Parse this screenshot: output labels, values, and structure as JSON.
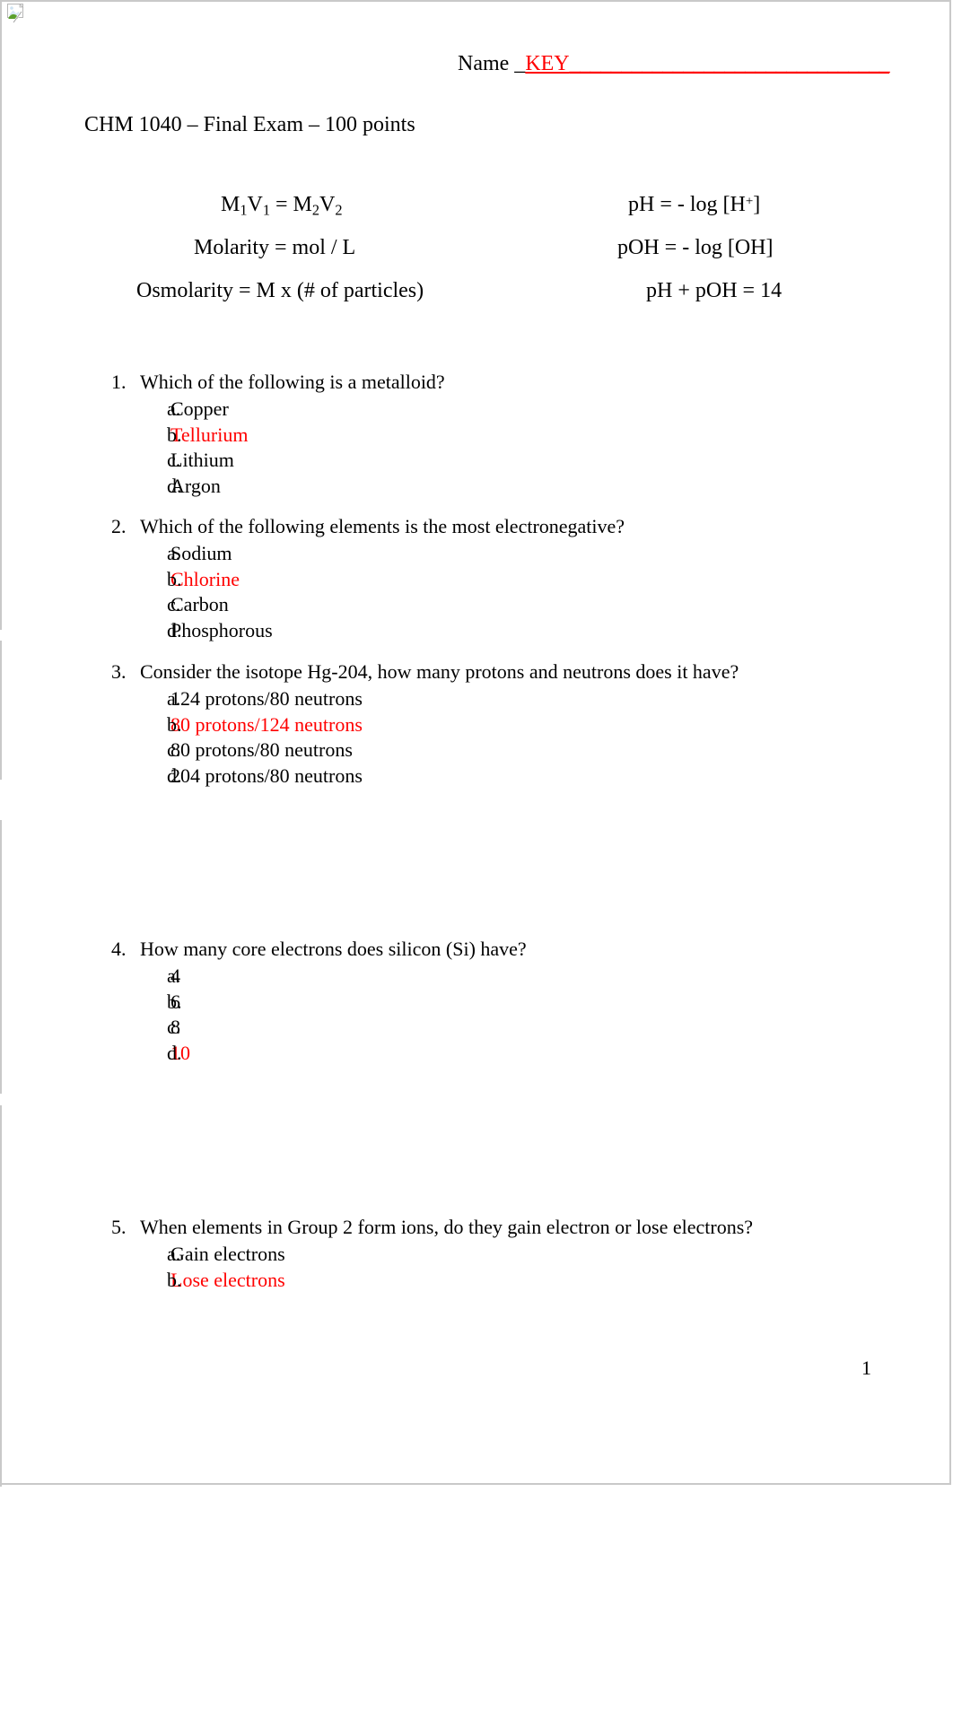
{
  "document": {
    "icon": "broken-image-placeholder-icon",
    "name_label": "Name _",
    "name_value": "KEY",
    "name_blank": "_______________________________",
    "course_title": "CHM 1040 – Final Exam – 100 points",
    "page_number": "1"
  },
  "formulas": {
    "rows": [
      {
        "left_parts": [
          {
            "t": "M",
            "s": "text"
          },
          {
            "t": "1",
            "s": "sub"
          },
          {
            "t": "V",
            "s": "text"
          },
          {
            "t": "1",
            "s": "sub"
          },
          {
            "t": " = M",
            "s": "text"
          },
          {
            "t": "2",
            "s": "sub"
          },
          {
            "t": "V",
            "s": "text"
          },
          {
            "t": "2",
            "s": "sub"
          }
        ],
        "left_plain": "M1V1 = M2V2",
        "right_parts": [
          {
            "t": "pH = - log [H",
            "s": "text"
          },
          {
            "t": "+",
            "s": "sup"
          },
          {
            "t": "]",
            "s": "text"
          }
        ],
        "right_plain": "pH = - log [H+]"
      },
      {
        "left_parts": [
          {
            "t": "Molarity = mol / L",
            "s": "text"
          }
        ],
        "left_plain": "Molarity = mol / L",
        "right_parts": [
          {
            "t": "pOH = - log [OH]",
            "s": "text"
          }
        ],
        "right_plain": "pOH = - log [OH]"
      },
      {
        "left_parts": [
          {
            "t": "Osmolarity = M x (# of particles)",
            "s": "text"
          }
        ],
        "left_plain": "Osmolarity = M x (# of particles)",
        "right_parts": [
          {
            "t": "pH + pOH = 14",
            "s": "text"
          }
        ],
        "right_plain": "pH + pOH = 14"
      }
    ]
  },
  "questions": [
    {
      "number": "1.",
      "text": "Which of the following is a metalloid?",
      "answers": [
        {
          "letter": "a.",
          "text": "Copper",
          "correct": false
        },
        {
          "letter": "b.",
          "text": "Tellurium",
          "correct": true
        },
        {
          "letter": "c.",
          "text": "Lithium",
          "correct": false
        },
        {
          "letter": "d.",
          "text": "Argon",
          "correct": false
        }
      ]
    },
    {
      "number": "2.",
      "text": "Which of the following elements is the most electronegative?",
      "answers": [
        {
          "letter": "a.",
          "text": "Sodium",
          "correct": false
        },
        {
          "letter": "b.",
          "text": "Chlorine",
          "correct": true
        },
        {
          "letter": "c.",
          "text": "Carbon",
          "correct": false
        },
        {
          "letter": "d.",
          "text": "Phosphorous",
          "correct": false
        }
      ]
    },
    {
      "number": "3.",
      "text": "Consider the isotope Hg-204, how many protons and neutrons does it have?",
      "answers": [
        {
          "letter": "a.",
          "text": "124 protons/80 neutrons",
          "correct": false
        },
        {
          "letter": "b.",
          "text": "80 protons/124 neutrons",
          "correct": true
        },
        {
          "letter": "c.",
          "text": "80 protons/80 neutrons",
          "correct": false
        },
        {
          "letter": "d.",
          "text": "204 protons/80 neutrons",
          "correct": false
        }
      ]
    },
    {
      "number": "4.",
      "text": "How many core electrons does silicon (Si) have?",
      "answers": [
        {
          "letter": "a.",
          "text": "4",
          "correct": false
        },
        {
          "letter": "b.",
          "text": "6",
          "correct": false
        },
        {
          "letter": "c.",
          "text": "8",
          "correct": false
        },
        {
          "letter": "d.",
          "text": "10",
          "correct": true
        }
      ]
    },
    {
      "number": "5.",
      "text": "When elements in Group 2 form ions, do they gain electron or lose electrons?",
      "answers": [
        {
          "letter": "a.",
          "text": "Gain electrons",
          "correct": false
        },
        {
          "letter": "b.",
          "text": "Lose electrons",
          "correct": true
        }
      ]
    }
  ],
  "colors": {
    "answer_red": "#ff0000",
    "page_border": "#c9c9c9",
    "text": "#000000"
  }
}
